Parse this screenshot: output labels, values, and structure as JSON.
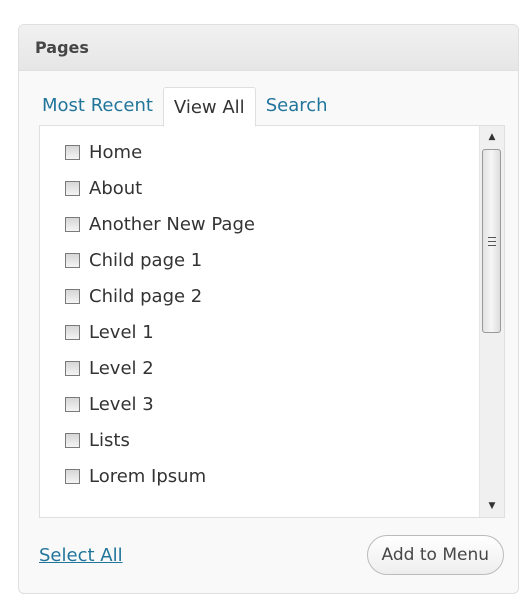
{
  "panel": {
    "title": "Pages"
  },
  "tabs": [
    {
      "label": "Most Recent",
      "active": false
    },
    {
      "label": "View All",
      "active": true
    },
    {
      "label": "Search",
      "active": false
    }
  ],
  "pages": [
    {
      "label": "Home",
      "checked": false
    },
    {
      "label": "About",
      "checked": false
    },
    {
      "label": "Another New Page",
      "checked": false
    },
    {
      "label": "Child page 1",
      "checked": false
    },
    {
      "label": "Child page 2",
      "checked": false
    },
    {
      "label": "Level 1",
      "checked": false
    },
    {
      "label": "Level 2",
      "checked": false
    },
    {
      "label": "Level 3",
      "checked": false
    },
    {
      "label": "Lists",
      "checked": false
    },
    {
      "label": "Lorem Ipsum",
      "checked": false
    }
  ],
  "scrollbar": {
    "up_icon": "triangle-up",
    "down_icon": "triangle-down",
    "grip_icon": "grip-lines"
  },
  "footer": {
    "select_all_label": "Select All",
    "add_button_label": "Add to Menu"
  },
  "colors": {
    "link": "#21759b",
    "text": "#333333",
    "header_bg": "#e9e9e9",
    "border": "#dfdfdf"
  }
}
